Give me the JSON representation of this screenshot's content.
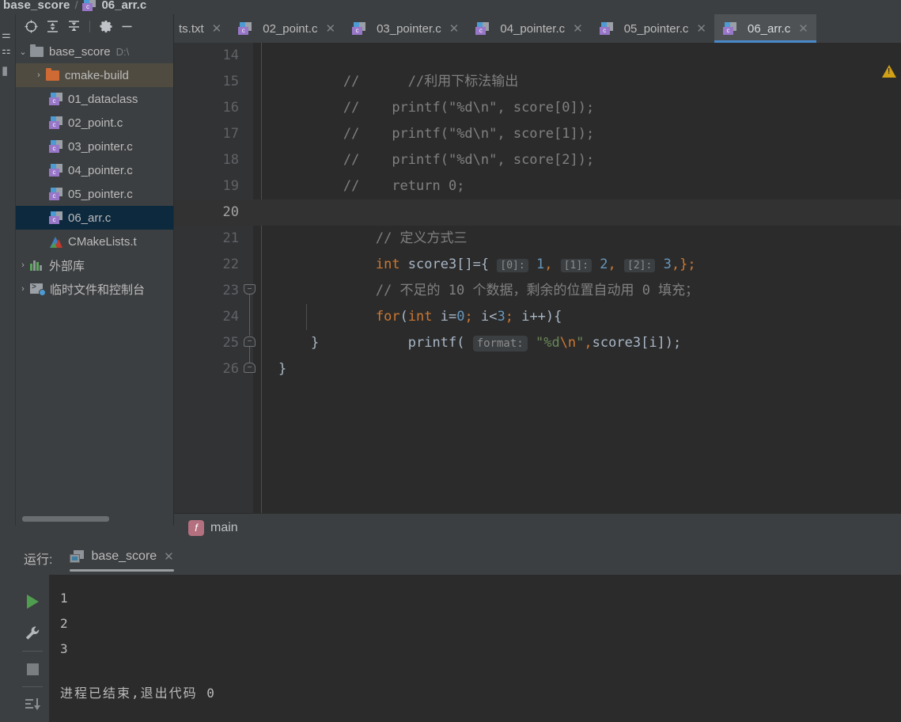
{
  "breadcrumb": {
    "project": "base_score",
    "separator": "/",
    "file": "06_arr.c",
    "file_icon": "c-file-icon"
  },
  "left_strip": {
    "icons": [
      "structure-icon",
      "bookmarks-icon",
      "project-folder-icon"
    ]
  },
  "project_panel": {
    "toolbar": [
      {
        "name": "select-opened-file-icon",
        "glyph": "⊕"
      },
      {
        "name": "expand-all-icon",
        "glyph": "expand"
      },
      {
        "name": "collapse-all-icon",
        "glyph": "collapse"
      },
      {
        "name": "settings-gear-icon",
        "glyph": "⚙"
      },
      {
        "name": "hide-panel-icon",
        "glyph": "—"
      }
    ],
    "tree": [
      {
        "label": "base_score",
        "path": "D:\\",
        "icon": "folder-icon",
        "indent": 0,
        "arrow": "⌄",
        "selected": "none",
        "type": "folder"
      },
      {
        "label": "cmake-build",
        "path": "",
        "icon": "folder-orange-icon",
        "indent": 1,
        "arrow": "›",
        "selected": "olive",
        "type": "folder-orange"
      },
      {
        "label": "01_dataclass",
        "path": "",
        "icon": "c-file-icon",
        "indent": 2,
        "arrow": "",
        "selected": "none",
        "type": "cfile"
      },
      {
        "label": "02_point.c",
        "path": "",
        "icon": "c-file-icon",
        "indent": 2,
        "arrow": "",
        "selected": "none",
        "type": "cfile"
      },
      {
        "label": "03_pointer.c",
        "path": "",
        "icon": "c-file-icon",
        "indent": 2,
        "arrow": "",
        "selected": "none",
        "type": "cfile"
      },
      {
        "label": "04_pointer.c",
        "path": "",
        "icon": "c-file-icon",
        "indent": 2,
        "arrow": "",
        "selected": "none",
        "type": "cfile"
      },
      {
        "label": "05_pointer.c",
        "path": "",
        "icon": "c-file-icon",
        "indent": 2,
        "arrow": "",
        "selected": "none",
        "type": "cfile"
      },
      {
        "label": "06_arr.c",
        "path": "",
        "icon": "c-file-icon",
        "indent": 2,
        "arrow": "",
        "selected": "blue",
        "type": "cfile"
      },
      {
        "label": "CMakeLists.t",
        "path": "",
        "icon": "cmake-icon",
        "indent": 2,
        "arrow": "",
        "selected": "none",
        "type": "cmake"
      },
      {
        "label": "外部库",
        "path": "",
        "icon": "external-libraries-icon",
        "indent": 0,
        "arrow": "›",
        "selected": "none",
        "type": "lib"
      },
      {
        "label": "临时文件和控制台",
        "path": "",
        "icon": "scratches-consoles-icon",
        "indent": 0,
        "arrow": "›",
        "selected": "none",
        "type": "term"
      }
    ]
  },
  "editor_tabs": [
    {
      "label": "ts.txt",
      "icon": "none",
      "active": false,
      "clipped": true
    },
    {
      "label": "02_point.c",
      "icon": "c-file-icon",
      "active": false,
      "clipped": false
    },
    {
      "label": "03_pointer.c",
      "icon": "c-file-icon",
      "active": false,
      "clipped": false
    },
    {
      "label": "04_pointer.c",
      "icon": "c-file-icon",
      "active": false,
      "clipped": false
    },
    {
      "label": "05_pointer.c",
      "icon": "c-file-icon",
      "active": false,
      "clipped": false
    },
    {
      "label": "06_arr.c",
      "icon": "c-file-icon",
      "active": true,
      "clipped": false
    }
  ],
  "editor": {
    "first_line": 14,
    "current_line": 20,
    "warning_icon": "warning-triangle-icon",
    "lines": [
      {
        "n": "14",
        "fold": "",
        "tokens": [
          {
            "t": "//",
            "c": "c-cmt"
          },
          {
            "t": "      //利用下标法输出",
            "c": "c-cmt-zh"
          }
        ]
      },
      {
        "n": "15",
        "fold": "",
        "tokens": [
          {
            "t": "//",
            "c": "c-cmt"
          },
          {
            "t": "    printf(\"%d\\n\", score[0]);",
            "c": "c-cmt"
          }
        ]
      },
      {
        "n": "16",
        "fold": "",
        "tokens": [
          {
            "t": "//",
            "c": "c-cmt"
          },
          {
            "t": "    printf(\"%d\\n\", score[1]);",
            "c": "c-cmt"
          }
        ]
      },
      {
        "n": "17",
        "fold": "",
        "tokens": [
          {
            "t": "//",
            "c": "c-cmt"
          },
          {
            "t": "    printf(\"%d\\n\", score[2]);",
            "c": "c-cmt"
          }
        ]
      },
      {
        "n": "18",
        "fold": "",
        "tokens": [
          {
            "t": "//",
            "c": "c-cmt"
          },
          {
            "t": "    return 0;",
            "c": "c-cmt"
          }
        ]
      },
      {
        "n": "19",
        "fold": "",
        "tokens": []
      },
      {
        "n": "20",
        "fold": "",
        "tokens": [
          {
            "t": "    // 定义方式三",
            "c": "c-cmt-zh"
          }
        ]
      },
      {
        "n": "21",
        "fold": "",
        "tokens": []
      },
      {
        "n": "22",
        "fold": "",
        "tokens": [
          {
            "t": "    // 不足的 10 个数据，剩余的位置自动用 0 填充；",
            "c": "c-cmt-zh"
          }
        ]
      },
      {
        "n": "23",
        "fold": "down",
        "tokens": []
      },
      {
        "n": "24",
        "fold": "",
        "tokens": []
      },
      {
        "n": "25",
        "fold": "up",
        "tokens": []
      },
      {
        "n": "26",
        "fold": "up",
        "tokens": []
      }
    ],
    "line21": {
      "keyword": "int",
      "name": " score3[]={",
      "hints": [
        "[0]:",
        "[1]:",
        "[2]:"
      ],
      "values": [
        "1",
        "2",
        "3"
      ],
      "tail": ",};"
    },
    "line23": {
      "kw_for": "for",
      "p1": "(",
      "kw_int": "int",
      "var": " i=",
      "zero": "0",
      "semi1": ";",
      "cond_var": " i<",
      "three": "3",
      "semi2": ";",
      "inc": " i++",
      "p2": ")",
      "brace": "{"
    },
    "line24": {
      "call": "printf",
      "paren": "(",
      "hint": "format:",
      "str_open": "\"%d",
      "escape": "\\n",
      "str_close": "\"",
      "comma": ",",
      "args": "score3[i]",
      "close": ");"
    },
    "line25": {
      "text": "}"
    },
    "line26": {
      "text": "}"
    }
  },
  "function_bar": {
    "badge": "f",
    "name": "main"
  },
  "run_window": {
    "label": "运行:",
    "tab_name": "base_score",
    "tab_icon": "run-configuration-icon",
    "close_icon": "close-icon",
    "side_buttons": [
      {
        "name": "rerun-button",
        "icon": "play-icon"
      },
      {
        "name": "edit-configuration-button",
        "icon": "wrench-icon"
      },
      {
        "name": "stop-button",
        "icon": "stop-icon"
      },
      {
        "name": "scroll-to-end-button",
        "icon": "scroll-to-end-icon"
      }
    ],
    "console_lines": [
      "1",
      "2",
      "3"
    ],
    "exit_message": "进程已结束,退出代码 0"
  },
  "colors": {
    "background": "#3c3f41",
    "editor_bg": "#2b2b2b",
    "gutter_bg": "#313335",
    "accent_blue": "#4a88c7",
    "selection_blue": "#0d293e",
    "selection_olive": "#4f4b41",
    "keyword_orange": "#cc7832",
    "number_blue": "#6897bb",
    "string_green": "#6a8759",
    "comment_gray": "#808080",
    "text_gray": "#a9b7c6",
    "warning_yellow": "#d1a015"
  }
}
